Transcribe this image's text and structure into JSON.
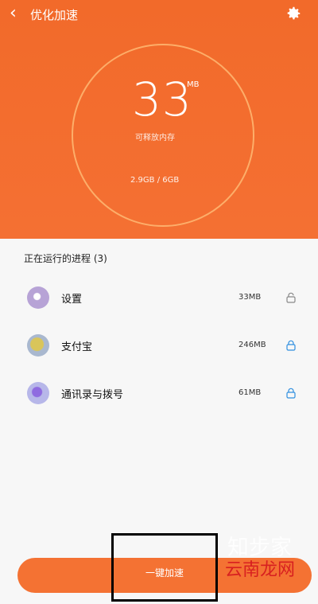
{
  "header": {
    "title": "优化加速"
  },
  "memory": {
    "value": "33",
    "unit": "MB",
    "label": "可释放内存",
    "usage": "2.9GB / 6GB"
  },
  "processes": {
    "section_title": "正在运行的进程 (3)",
    "items": [
      {
        "name": "设置",
        "size": "33MB",
        "locked": false
      },
      {
        "name": "支付宝",
        "size": "246MB",
        "locked": true
      },
      {
        "name": "通讯录与拨号",
        "size": "61MB",
        "locked": true
      }
    ]
  },
  "action": {
    "label": "一键加速"
  },
  "watermark": {
    "line1": "知步家",
    "line2": "云南龙网"
  },
  "colors": {
    "accent": "#f47033",
    "lock_blue": "#2f8fe0",
    "lock_gray": "#888888"
  },
  "icons": {
    "back": "back-icon",
    "settings": "gear-icon",
    "lock": "lock-icon"
  }
}
